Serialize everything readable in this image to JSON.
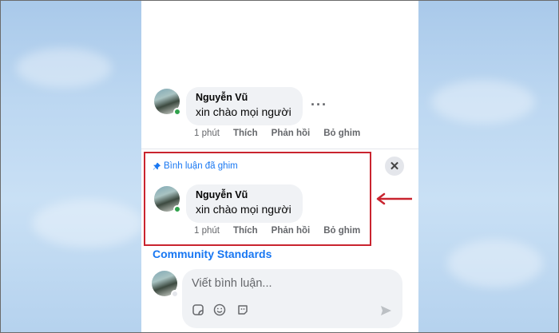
{
  "comment_top": {
    "author": "Nguyễn Vũ",
    "text": "xin chào mọi người",
    "time": "1 phút",
    "like": "Thích",
    "reply": "Phản hồi",
    "unpin": "Bỏ ghim"
  },
  "pinned": {
    "label": "Bình luận đã ghim",
    "author": "Nguyễn Vũ",
    "text": "xin chào mọi người",
    "time": "1 phút",
    "like": "Thích",
    "reply": "Phản hồi",
    "unpin": "Bỏ ghim"
  },
  "community_link": "Community Standards",
  "composer": {
    "placeholder": "Viết bình luận..."
  },
  "icons": [
    "pin-icon",
    "close-icon",
    "sticker-icon",
    "emoji-icon",
    "gif-icon",
    "send-icon",
    "more-options-icon"
  ],
  "colors": {
    "highlight": "#c9242f",
    "link": "#1877f2",
    "online": "#31a24c"
  }
}
